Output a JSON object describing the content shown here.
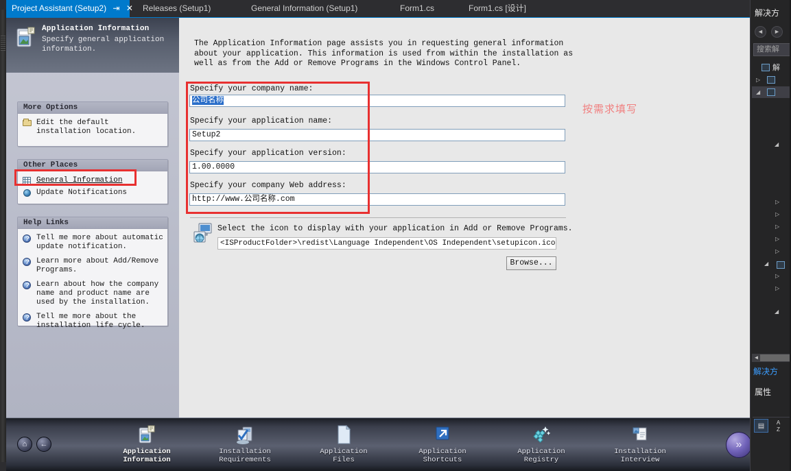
{
  "window": {
    "tabs": [
      {
        "label": "Project Assistant (Setup2)",
        "active": true,
        "pin": "⇥",
        "close": "✕"
      },
      {
        "label": "Releases (Setup1)",
        "active": false
      },
      {
        "label": "General Information (Setup1)",
        "active": false
      },
      {
        "label": "Form1.cs",
        "active": false
      },
      {
        "label": "Form1.cs [设计]",
        "active": false
      }
    ],
    "overflow_chevron": "▾"
  },
  "project_assistant": {
    "header": {
      "title": "Application Information",
      "subtitle": "Specify general application information."
    },
    "panels": [
      {
        "name": "more-options",
        "title": "More Options",
        "items": [
          {
            "icon": "folder-icon",
            "text": "Edit the default installation location.",
            "link": false
          }
        ]
      },
      {
        "name": "other-places",
        "title": "Other Places",
        "items": [
          {
            "icon": "grid-icon",
            "text": "General Information",
            "link": true,
            "highlighted": true
          },
          {
            "icon": "globe-icon",
            "text": "Update Notifications",
            "link": false
          }
        ]
      },
      {
        "name": "help-links",
        "title": "Help Links",
        "items": [
          {
            "icon": "help-icon",
            "text": "Tell me more about automatic update notification.",
            "link": false
          },
          {
            "icon": "help-icon",
            "text": "Learn more about Add/Remove Programs.",
            "link": false
          },
          {
            "icon": "help-icon",
            "text": "Learn about how the company name and product name are used by the installation.",
            "link": false
          },
          {
            "icon": "help-icon",
            "text": "Tell me more about the installation life cycle.",
            "link": false
          }
        ]
      }
    ],
    "intro": "The Application Information page assists you in requesting general information about your application. This information is used from within the installation as well as from the Add or Remove Programs in the Windows Control Panel.",
    "fields": [
      {
        "name": "company-name",
        "label": "Specify your company name:",
        "value": "公司名称",
        "selected": true
      },
      {
        "name": "application-name",
        "label": "Specify your application name:",
        "value": "Setup2",
        "selected": false
      },
      {
        "name": "application-version",
        "label": "Specify your application version:",
        "value": "1.00.0000",
        "selected": false
      },
      {
        "name": "company-web-address",
        "label": "Specify your company Web address:",
        "value": "http://www.公司名称.com",
        "selected": false
      }
    ],
    "icon_section": {
      "description": "Select the icon to display with your application in Add or Remove Programs.",
      "path": "<ISProductFolder>\\redist\\Language Independent\\OS Independent\\setupicon.ico",
      "browse_label": "Browse..."
    },
    "annotation": {
      "note": "按需求填写",
      "color": "#e83030"
    },
    "wizard": {
      "home_glyph": "⌂",
      "back_glyph": "←",
      "next_glyph": "»",
      "steps": [
        {
          "name": "application-information",
          "label_line1": "Application",
          "label_line2": "Information",
          "icon": "app-info-icon",
          "current": true
        },
        {
          "name": "installation-requirements",
          "label_line1": "Installation",
          "label_line2": "Requirements",
          "icon": "requirements-icon",
          "current": false
        },
        {
          "name": "application-files",
          "label_line1": "Application",
          "label_line2": "Files",
          "icon": "files-icon",
          "current": false
        },
        {
          "name": "application-shortcuts",
          "label_line1": "Application",
          "label_line2": "Shortcuts",
          "icon": "shortcut-icon",
          "current": false
        },
        {
          "name": "application-registry",
          "label_line1": "Application",
          "label_line2": "Registry",
          "icon": "registry-icon",
          "current": false
        },
        {
          "name": "installation-interview",
          "label_line1": "Installation",
          "label_line2": "Interview",
          "icon": "interview-icon",
          "current": false
        }
      ]
    }
  },
  "right_pane": {
    "title": "解决方",
    "nav_back": "◄",
    "nav_forward": "►",
    "search_placeholder": "搜索解",
    "tree": [
      {
        "label": "解",
        "icon": "solution-icon",
        "expander": "",
        "selected": false
      },
      {
        "label": "",
        "icon": "project-icon",
        "expander": "▷",
        "selected": false
      },
      {
        "label": "",
        "icon": "project-icon",
        "expander": "◢",
        "selected": true
      }
    ],
    "hscroll_arrow": "◄",
    "solution_tab": "解决方",
    "properties_title": "属性",
    "prop_buttons": [
      {
        "name": "categorized-view-button",
        "glyph": "▤"
      },
      {
        "name": "alphabetical-view-button",
        "glyph": "A\nZ"
      }
    ]
  }
}
